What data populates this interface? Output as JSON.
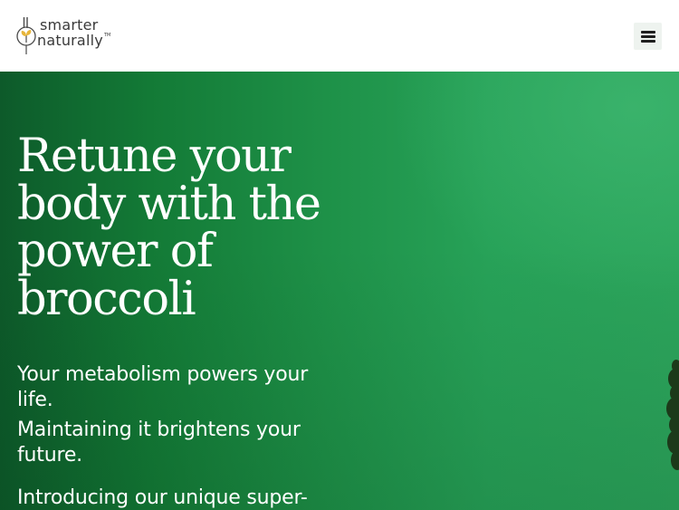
{
  "header": {
    "logo": {
      "line1": "smarter",
      "line2": "naturally",
      "tm": "TM",
      "icon": "broccoli-sprout-icon"
    },
    "menu_button": {
      "icon": "hamburger-menu-icon"
    }
  },
  "hero": {
    "headline_lines": [
      "Retune your",
      "body with the",
      "power of",
      "broccoli"
    ],
    "paragraph1_lines": [
      "Your metabolism powers your",
      "life."
    ],
    "paragraph2_lines": [
      "Maintaining it brightens your",
      "future."
    ],
    "paragraph3_lines": [
      "Introducing our unique super-"
    ]
  },
  "colors": {
    "hero_green": "#1e9148",
    "text_white": "#ffffff",
    "logo_text": "#3a3a3a"
  }
}
